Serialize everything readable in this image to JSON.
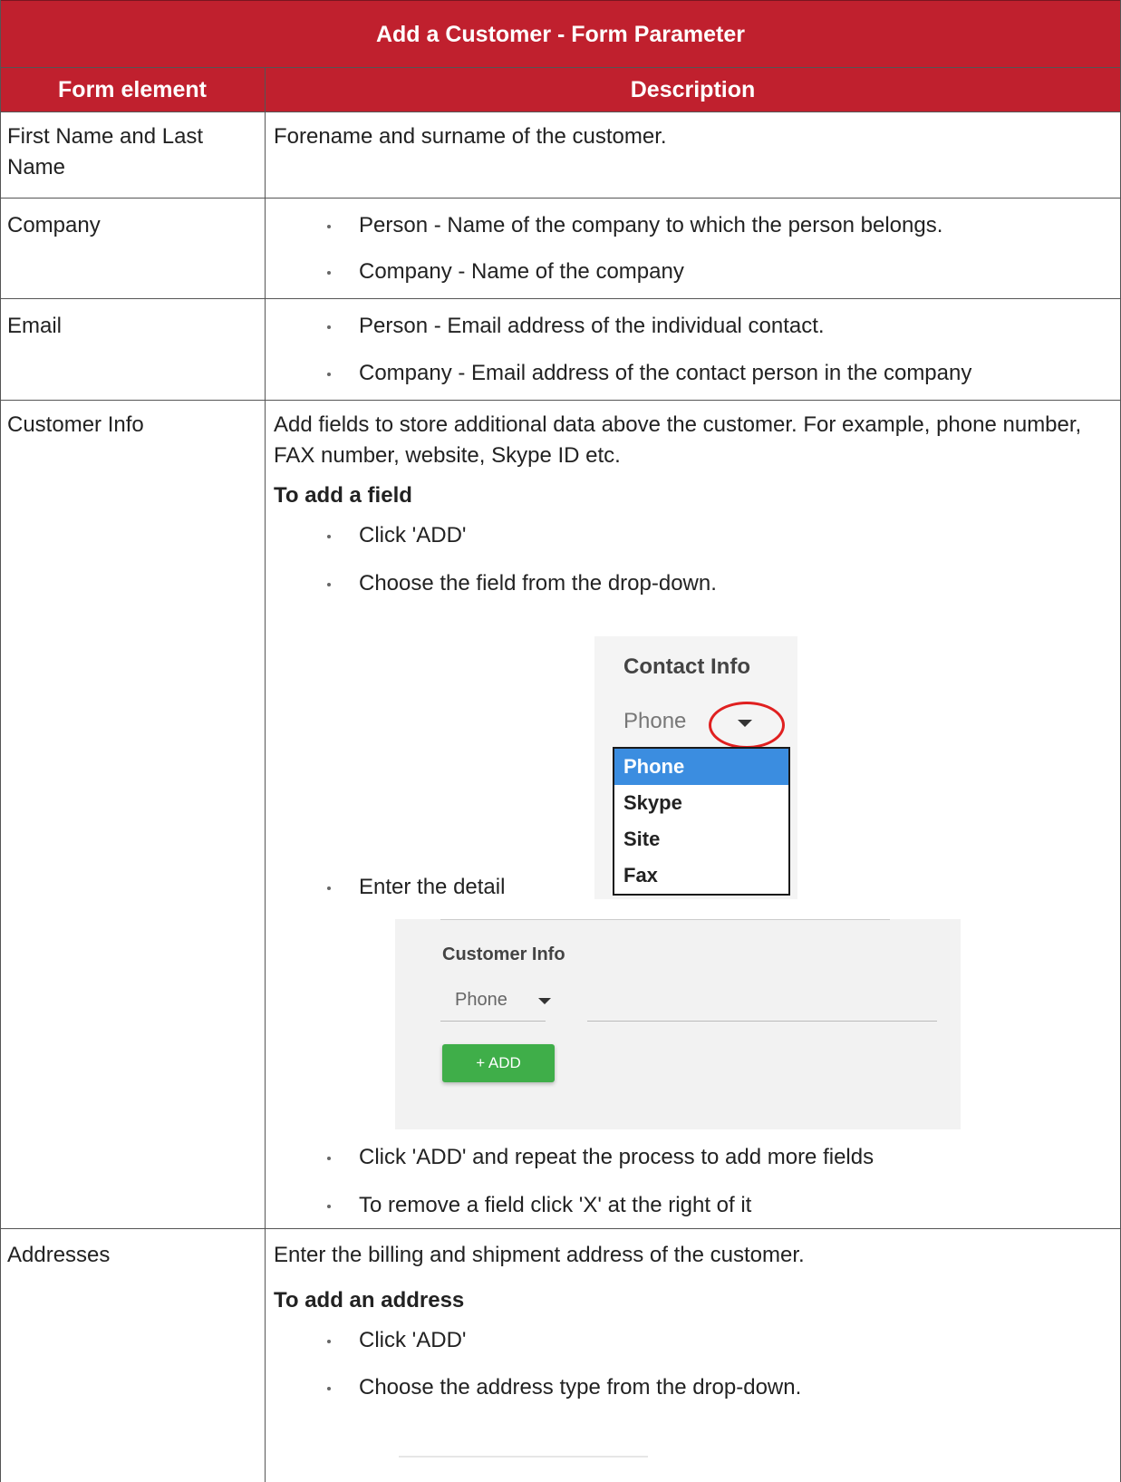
{
  "table": {
    "caption": "Add a Customer - Form Parameter",
    "col_headers": [
      "Form element",
      "Description"
    ]
  },
  "rows": {
    "name": {
      "element_line1": "First Name and Last",
      "element_line2": "Name",
      "desc": "Forename and surname of the customer."
    },
    "company": {
      "element": "Company",
      "bullets": [
        "Person - Name of the company to which the person belongs.",
        "Company - Name of the company"
      ]
    },
    "email": {
      "element": "Email",
      "bullets": [
        "Person - Email address of the individual contact.",
        "Company - Email address of the contact person in the company"
      ]
    },
    "customer_info": {
      "element": "Customer Info",
      "desc_line1": "Add fields to store additional data above the customer. For example, phone number,",
      "desc_line2": "FAX number, website, Skype ID etc.",
      "subheading": "To add a field",
      "bullets": [
        "Click 'ADD'",
        "Choose the field from the drop-down.",
        "Enter the detail",
        "Click 'ADD' and repeat the process to add more fields",
        "To remove a field click 'X' at the right of it"
      ]
    },
    "addresses": {
      "element": "Addresses",
      "desc": "Enter the billing and shipment address of the customer.",
      "subheading": "To add an address",
      "bullets": [
        "Click 'ADD'",
        "Choose the address type from the drop-down."
      ]
    }
  },
  "screenshot_contact_info": {
    "title": "Contact Info",
    "selected": "Phone",
    "options": [
      "Phone",
      "Skype",
      "Site",
      "Fax"
    ]
  },
  "screenshot_customer_info": {
    "title": "Customer Info",
    "selected": "Phone",
    "add_button": "+ ADD"
  },
  "colors": {
    "header_bg": "#c0202e",
    "button_green": "#3fae49",
    "highlight_blue": "#3b8de0",
    "ring_red": "#e02020"
  }
}
